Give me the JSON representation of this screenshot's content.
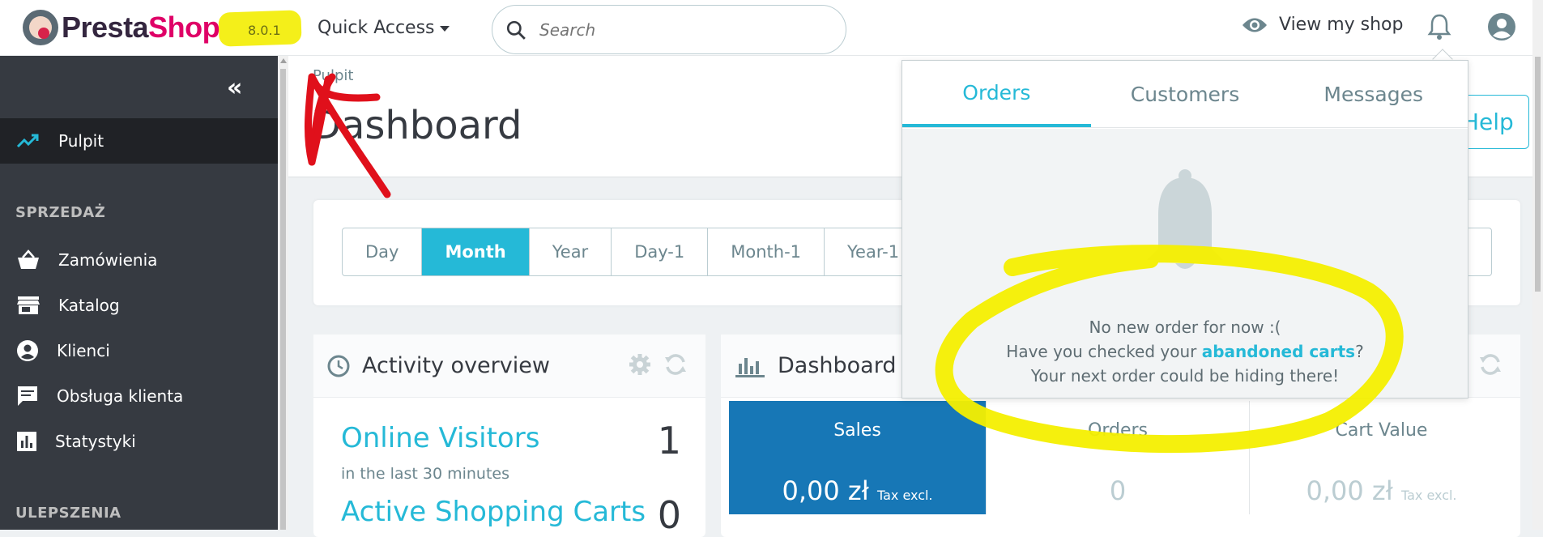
{
  "topbar": {
    "logo_presta": "Presta",
    "logo_shop": "Shop",
    "version": "8.0.1",
    "quick_access": "Quick Access",
    "search_placeholder": "Search",
    "view_shop": "View my shop"
  },
  "sidebar": {
    "collapse_glyph": "«",
    "active_item": "Pulpit",
    "section_sales": "SPRZEDAŻ",
    "items": [
      "Zamówienia",
      "Katalog",
      "Klienci",
      "Obsługa klienta",
      "Statystyki"
    ],
    "section_improvements": "ULEPSZENIA"
  },
  "header": {
    "breadcrumb": "Pulpit",
    "title": "Dashboard",
    "help": "Help"
  },
  "periods": [
    "Day",
    "Month",
    "Year",
    "Day-1",
    "Month-1",
    "Year-1"
  ],
  "active_period": "Month",
  "activity": {
    "title": "Activity overview",
    "online_label": "Online Visitors",
    "online_value": "1",
    "online_sub": "in the last 30 minutes",
    "carts_label": "Active Shopping Carts",
    "carts_value": "0"
  },
  "dashboard": {
    "title": "Dashboard",
    "kpis": [
      {
        "label": "Sales",
        "value": "0,00 zł",
        "suffix": "Tax excl."
      },
      {
        "label": "Orders",
        "value": "0",
        "suffix": ""
      },
      {
        "label": "Cart Value",
        "value": "0,00 zł",
        "suffix": "Tax excl."
      }
    ]
  },
  "notifications": {
    "tabs": [
      "Orders",
      "Customers",
      "Messages"
    ],
    "active_tab": "Orders",
    "line1": "No new order for now :(",
    "line2_before": "Have you checked your ",
    "line2_link": "abandoned carts",
    "line2_after": "?",
    "line3": "Your next order could be hiding there!"
  },
  "colors": {
    "accent": "#25b9d7",
    "sidebar": "#363a41",
    "sales_kpi": "#1777b6",
    "annotation_red": "#e0101b",
    "annotation_yellow": "#f4ef00"
  }
}
